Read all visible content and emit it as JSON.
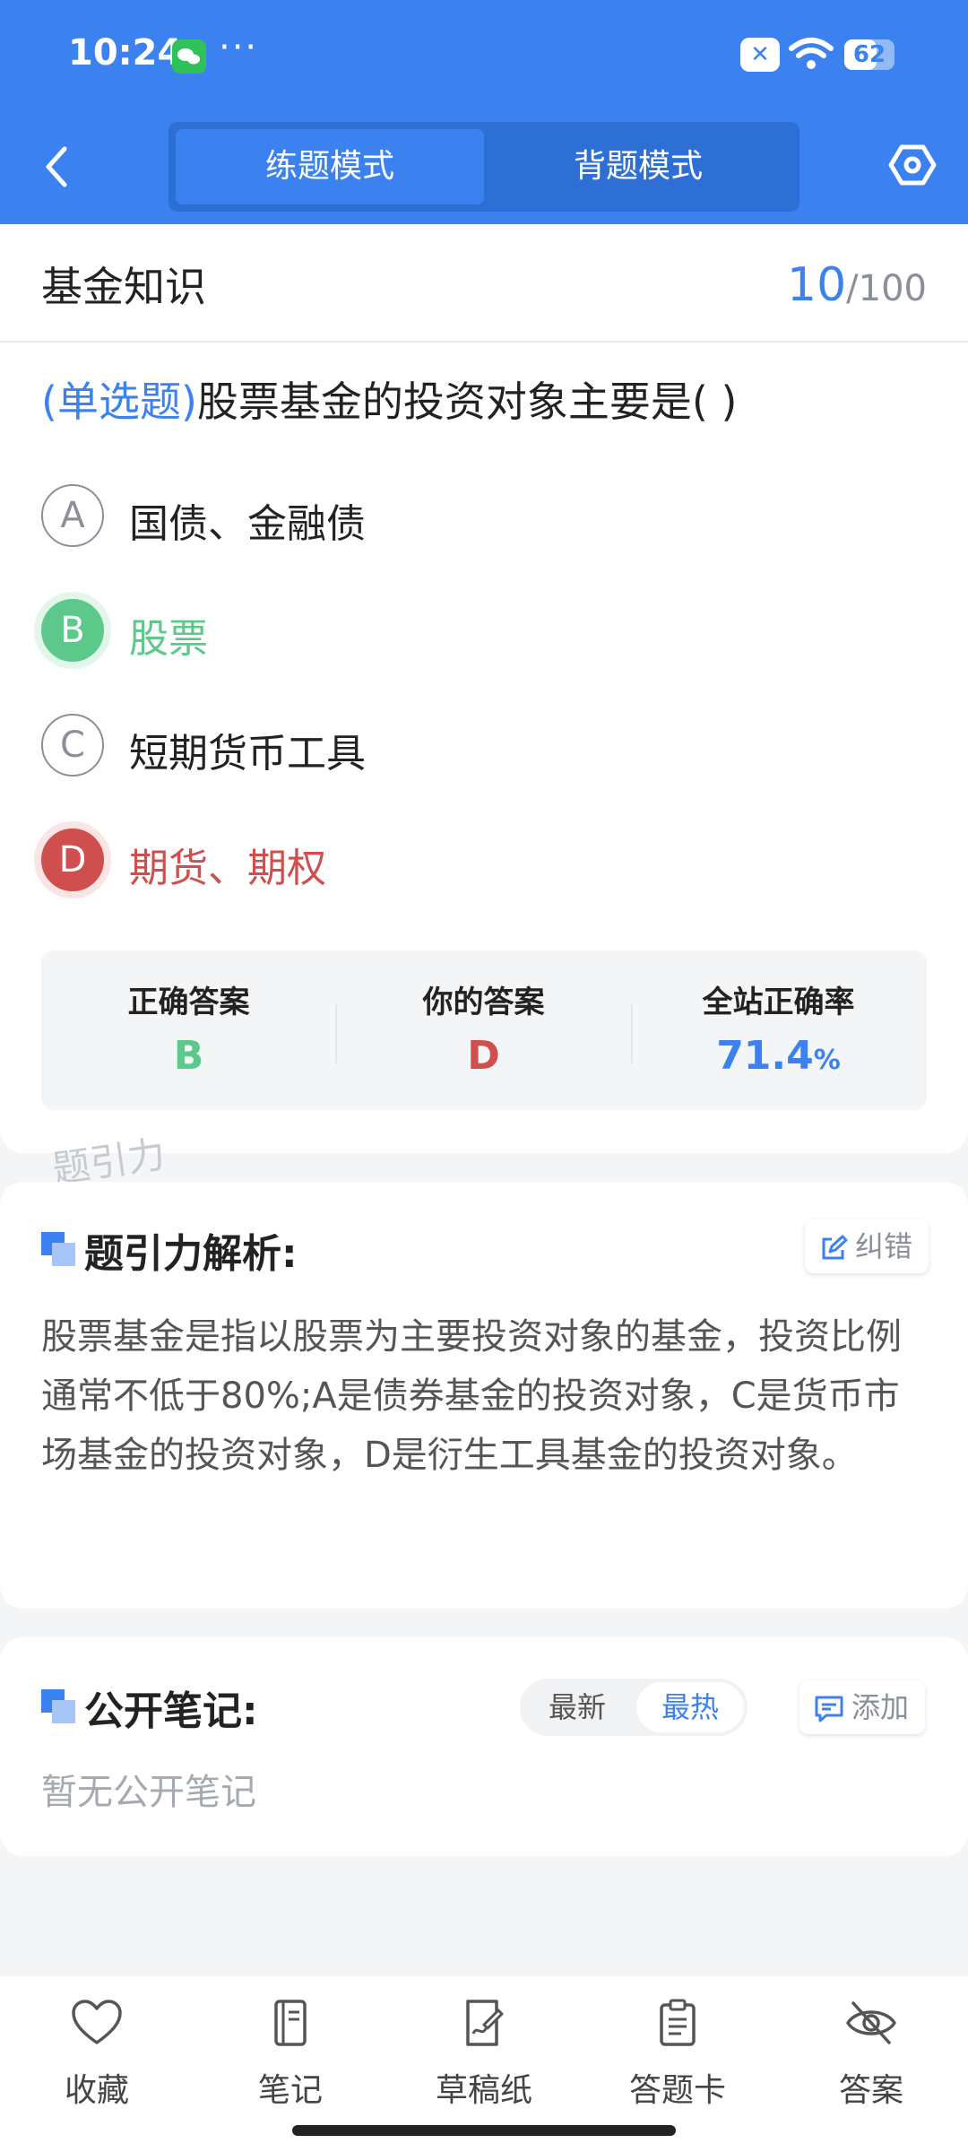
{
  "status_bar": {
    "time": "10:24",
    "more": "···",
    "battery": "62"
  },
  "header": {
    "tabs": [
      "练题模式",
      "背题模式"
    ],
    "active_tab": 0
  },
  "subject": {
    "title": "基金知识",
    "current": "10",
    "total": "/100"
  },
  "question": {
    "type_tag": "(单选题)",
    "text": "股票基金的投资对象主要是(        )",
    "options": [
      {
        "letter": "A",
        "text": "国债、金融债",
        "state": "normal"
      },
      {
        "letter": "B",
        "text": "股票",
        "state": "correct"
      },
      {
        "letter": "C",
        "text": "短期货币工具",
        "state": "normal"
      },
      {
        "letter": "D",
        "text": "期货、期权",
        "state": "wrong"
      }
    ]
  },
  "result": {
    "correct_label": "正确答案",
    "correct_value": "B",
    "yours_label": "你的答案",
    "yours_value": "D",
    "rate_label": "全站正确率",
    "rate_value": "71.4",
    "rate_unit": "%"
  },
  "watermark": "题引力",
  "analysis": {
    "title": "题引力解析:",
    "correct_button": "纠错",
    "text": "股票基金是指以股票为主要投资对象的基金，投资比例通常不低于80%;A是债券基金的投资对象，C是货币市场基金的投资对象，D是衍生工具基金的投资对象。"
  },
  "notes": {
    "title": "公开笔记:",
    "sort_options": [
      "最新",
      "最热"
    ],
    "active_sort": 1,
    "add_button": "添加",
    "empty": "暂无公开笔记"
  },
  "bottom_nav": [
    {
      "label": "收藏",
      "icon": "heart-icon"
    },
    {
      "label": "笔记",
      "icon": "notebook-icon"
    },
    {
      "label": "草稿纸",
      "icon": "draft-icon"
    },
    {
      "label": "答题卡",
      "icon": "clipboard-icon"
    },
    {
      "label": "答案",
      "icon": "eye-off-icon"
    }
  ],
  "colors": {
    "primary": "#3b82f0",
    "correct": "#5cc98b",
    "wrong": "#cf4e4e"
  }
}
